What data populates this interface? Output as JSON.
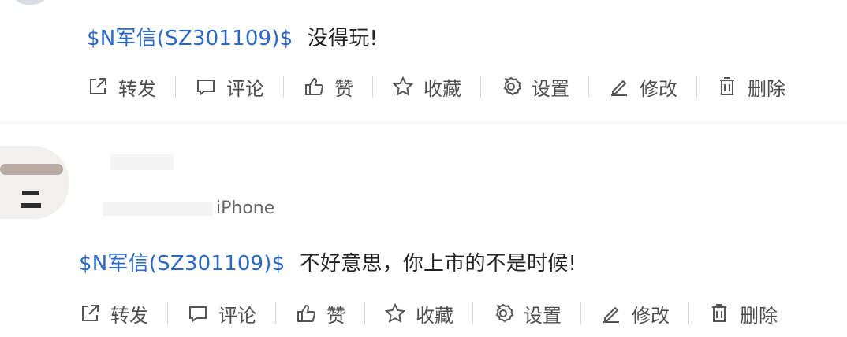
{
  "posts": [
    {
      "stock_tag": "$N军信(SZ301109)$",
      "text": "没得玩!",
      "actions": {
        "forward": "转发",
        "comment": "评论",
        "like": "赞",
        "favorite": "收藏",
        "settings": "设置",
        "edit": "修改",
        "delete": "删除"
      }
    },
    {
      "source": "iPhone",
      "stock_tag": "$N军信(SZ301109)$",
      "text": "不好意思，你上市的不是时候!",
      "actions": {
        "forward": "转发",
        "comment": "评论",
        "like": "赞",
        "favorite": "收藏",
        "settings": "设置",
        "edit": "修改",
        "delete": "删除"
      }
    }
  ],
  "colors": {
    "link": "#2a67c9",
    "text": "#222222",
    "action_text": "#4d4d4d",
    "background": "#f7f8fa",
    "card": "#ffffff"
  },
  "icons": {
    "forward": "share-icon",
    "comment": "comment-icon",
    "like": "thumbs-up-icon",
    "favorite": "star-icon",
    "settings": "gear-icon",
    "edit": "pencil-icon",
    "delete": "trash-icon"
  }
}
